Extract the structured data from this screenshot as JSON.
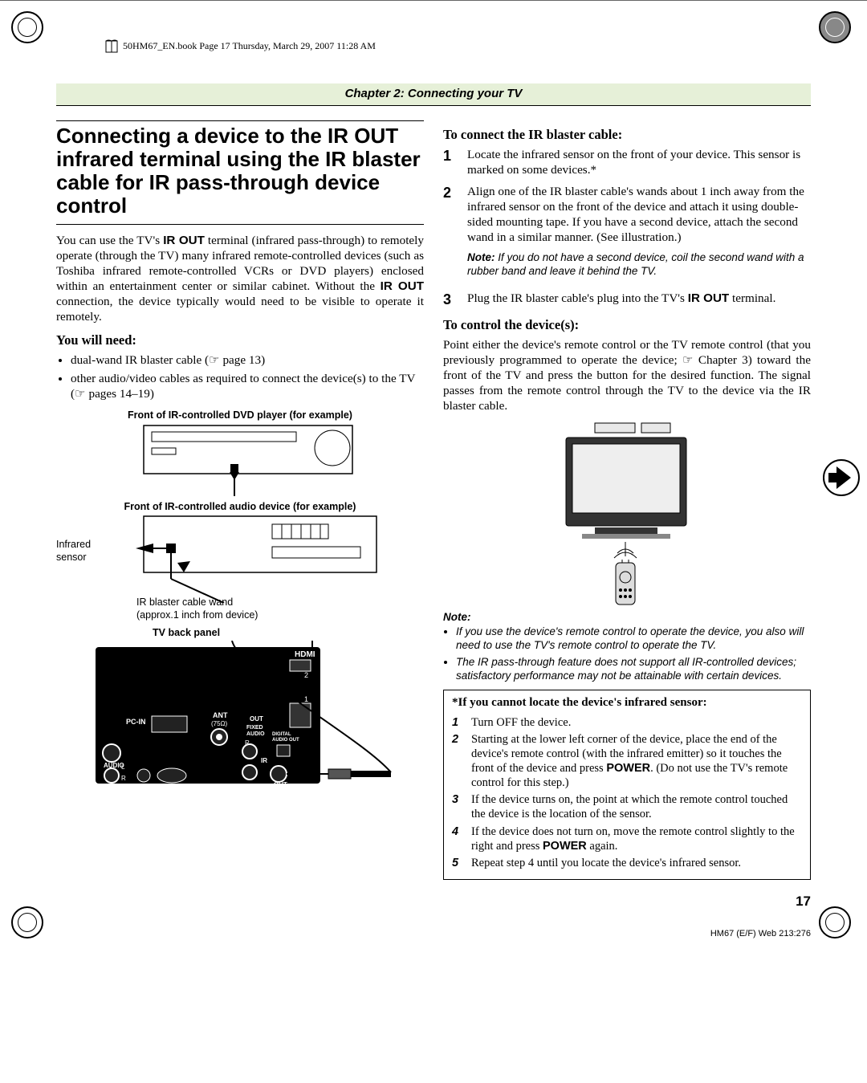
{
  "header_path": "50HM67_EN.book  Page 17  Thursday, March 29, 2007  11:28 AM",
  "chapter_band": "Chapter 2: Connecting your TV",
  "section_title": "Connecting a device to the IR OUT infrared terminal using the IR blaster cable for IR pass-through device control",
  "intro_para_pre": "You can use the TV's ",
  "intro_irout": "IR OUT",
  "intro_para_mid": " terminal (infrared pass-through) to remotely operate (through the TV) many infrared remote-controlled devices (such as Toshiba infrared remote-controlled VCRs or DVD players) enclosed within an entertainment center or similar cabinet. Without the ",
  "intro_para_post": " connection, the device typically would need to be visible to operate it remotely.",
  "you_will_need": "You will need:",
  "bullets": [
    "dual-wand IR blaster cable (☞ page 13)",
    "other audio/video cables as required to connect the device(s) to the TV (☞ pages 14–19)"
  ],
  "fig1_caption": "Front of IR-controlled DVD player (for example)",
  "fig2_caption": "Front of IR-controlled audio device (for example)",
  "fig_infrared_sensor": "Infrared sensor",
  "fig_wand_line1": "IR blaster cable wand",
  "fig_wand_line2": "(approx.1 inch from device)",
  "fig3_caption": "TV back panel",
  "panel_labels": {
    "pcin": "PC-IN",
    "audio": "AUDIO",
    "l": "L",
    "r": "R",
    "ant": "ANT",
    "ohm": "(75Ω)",
    "out": "OUT",
    "fixed": "FIXED",
    "audio2": "AUDIO",
    "ir": "IR",
    "digital": "DIGITAL",
    "audioout": "AUDIO OUT",
    "out2": "OUT",
    "hdmi": "HDMI",
    "one": "1",
    "two": "2"
  },
  "right": {
    "connect_head": "To connect the IR blaster cable:",
    "steps_connect": [
      "Locate the infrared sensor on the front of your device. This sensor is marked on some devices.*",
      "Align one of the IR blaster cable's wands about 1 inch away from the infrared sensor on the front of the device and attach it using double-sided mounting tape. If you have a second device, attach the second wand in a similar manner. (See illustration.)",
      "Plug the IR blaster cable's plug into the TV's IR OUT terminal."
    ],
    "note_after2_label": "Note:",
    "note_after2": " If you do not have a second device, coil the second wand with a rubber band and leave it behind the TV.",
    "control_head": "To control the device(s):",
    "control_para": "Point either the device's remote control or the TV remote control (that you previously programmed to operate the device; ☞ Chapter 3) toward the front of the TV and press the button for the desired function. The signal passes from the remote control through the TV to the device via the IR blaster cable.",
    "note_section_label": "Note:",
    "note_items": [
      "If you use the device's remote control to operate the device, you also will need to use the TV's remote control to operate the TV.",
      "The IR pass-through feature does not support all IR-controlled devices; satisfactory performance may not be attainable with certain devices."
    ],
    "box_head": "*If you cannot locate the device's infrared sensor:",
    "box_steps": [
      "Turn OFF the device.",
      "Starting at the lower left corner of the device, place the end of the device's remote control (with the infrared emitter) so it touches the front of the device and press POWER. (Do not use the TV's remote control for this step.)",
      "If the device turns on, the point at which the remote control touched the device is the location of the sensor.",
      "If the device does not turn on, move the remote control slightly to the right and press POWER again.",
      "Repeat step 4 until you locate the device's infrared sensor."
    ]
  },
  "page_num": "17",
  "footer_id": "HM67 (E/F) Web 213:276",
  "chart_data": {
    "type": "diagram",
    "description": "Wiring diagram: IR blaster cable from TV IR OUT to front of DVD player and audio device; plus TV-to-remote signal illustration",
    "components": [
      "DVD player front",
      "Audio device front",
      "Infrared sensor",
      "IR blaster cable wand",
      "TV back panel (PC-IN, AUDIO L/R, ANT 75Ω, FIXED AUDIO OUT, IR OUT, DIGITAL AUDIO OUT, HDMI 1/2)",
      "TV front with remote"
    ]
  }
}
